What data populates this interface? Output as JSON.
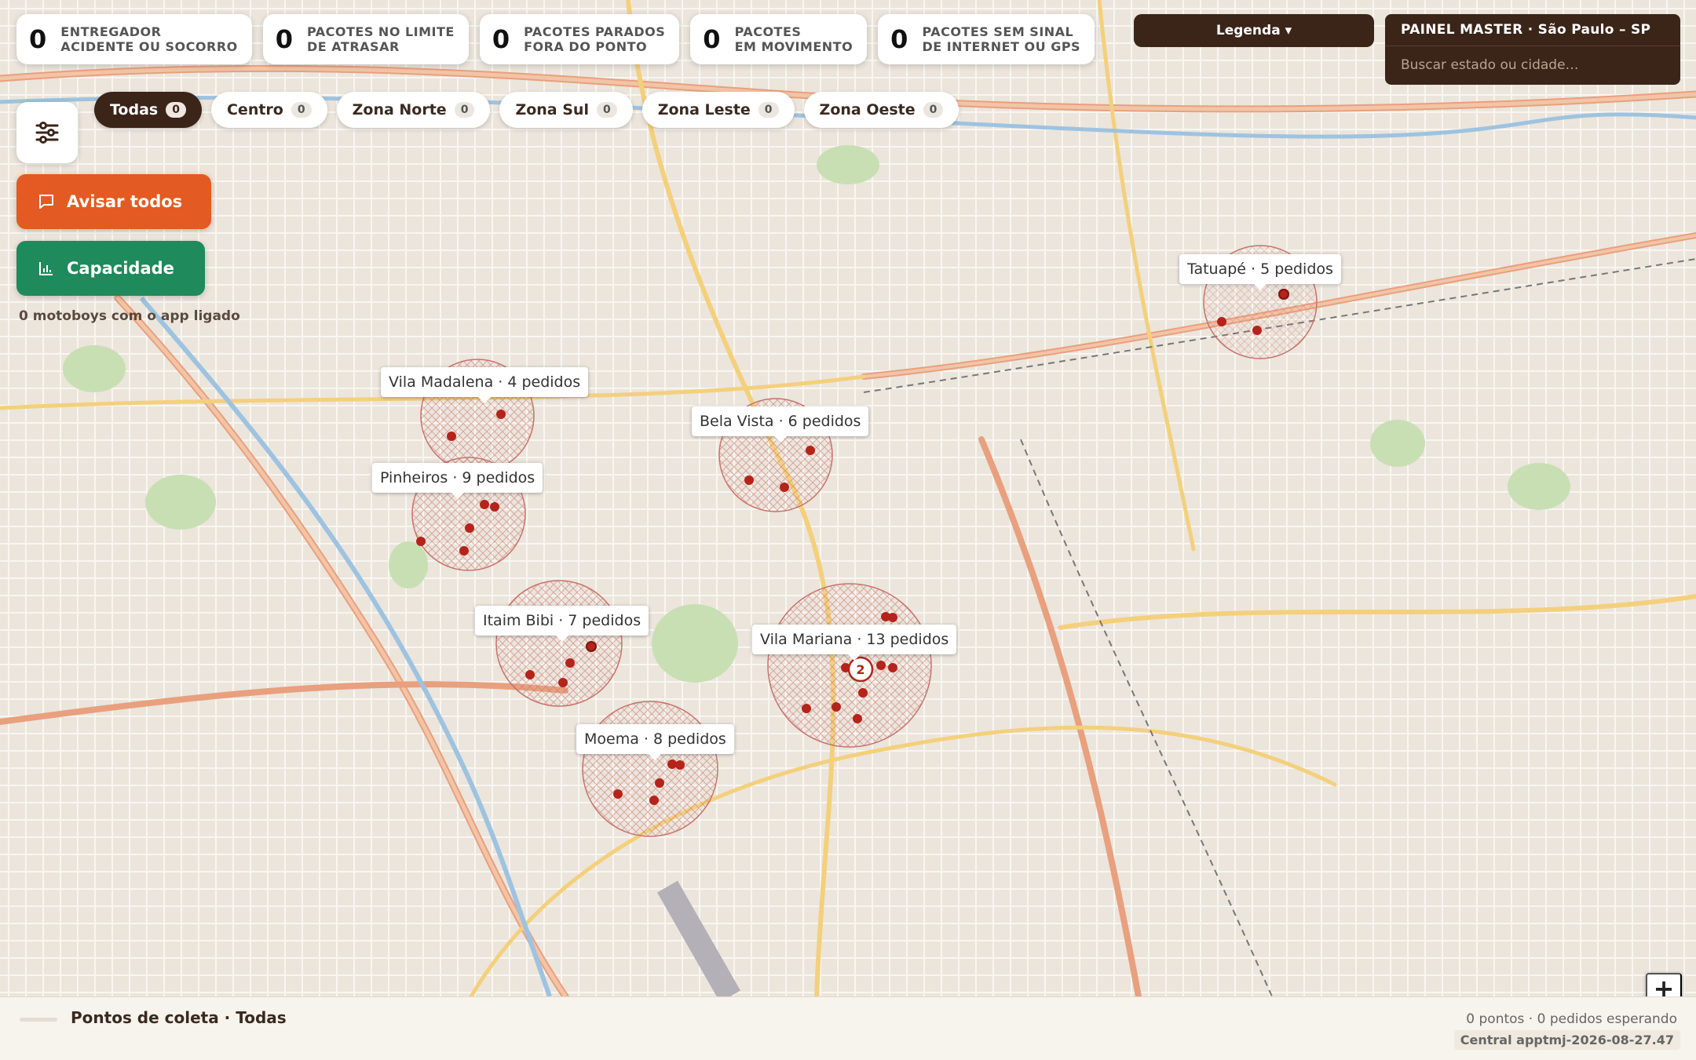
{
  "stats": [
    {
      "value": "0",
      "line1": "ENTREGADOR",
      "line2": "ACIDENTE OU SOCORRO"
    },
    {
      "value": "0",
      "line1": "PACOTES NO LIMITE",
      "line2": "DE ATRASAR"
    },
    {
      "value": "0",
      "line1": "PACOTES PARADOS",
      "line2": "FORA DO PONTO"
    },
    {
      "value": "0",
      "line1": "PACOTES",
      "line2": "EM MOVIMENTO"
    },
    {
      "value": "0",
      "line1": "PACOTES SEM SINAL",
      "line2": "DE INTERNET OU GPS"
    }
  ],
  "legend_label": "Legenda ▾",
  "master": {
    "title": "PAINEL MASTER · São Paulo – SP",
    "search_placeholder": "Buscar estado ou cidade…"
  },
  "filters_icon": "sliders-icon",
  "chips": [
    {
      "label": "Todas",
      "count": "0",
      "active": true
    },
    {
      "label": "Centro",
      "count": "0"
    },
    {
      "label": "Zona Norte",
      "count": "0"
    },
    {
      "label": "Zona Sul",
      "count": "0"
    },
    {
      "label": "Zona Leste",
      "count": "0"
    },
    {
      "label": "Zona Oeste",
      "count": "0"
    }
  ],
  "actions": {
    "avisar": "Avisar todos",
    "capacidade": "Capacidade"
  },
  "motoboys": "0 motoboys com o app ligado",
  "zones": [
    {
      "label": "Tatuapé · 5 pedidos"
    },
    {
      "label": "Vila Madalena · 4 pedidos"
    },
    {
      "label": "Bela Vista · 6 pedidos"
    },
    {
      "label": "Pinheiros · 9 pedidos"
    },
    {
      "label": "Itaim Bibi · 7 pedidos"
    },
    {
      "label": "Vila Mariana · 13 pedidos"
    },
    {
      "label": "Moema · 8 pedidos"
    }
  ],
  "cluster_badge": "2",
  "zoom_in": "+",
  "bottom": {
    "title": "Pontos de coleta · Todas",
    "summary": "0 pontos · 0 pedidos esperando",
    "footer": "Central apptmj-2026-08-27.47"
  },
  "colors": {
    "brown": "#3b2418",
    "orange": "#e35a22",
    "green": "#1f8a5b",
    "marker": "#b5231b"
  }
}
